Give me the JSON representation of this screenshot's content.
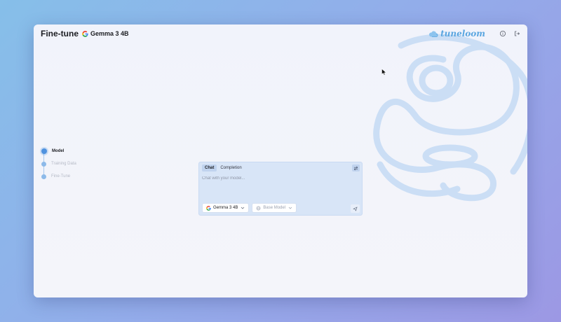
{
  "header": {
    "title": "Fine-tune",
    "model_name": "Gemma 3 4B",
    "brand": "tuneloom"
  },
  "stepper": {
    "steps": [
      {
        "label": "Model",
        "active": true
      },
      {
        "label": "Training Data",
        "active": false
      },
      {
        "label": "Fine-Tune",
        "active": false
      }
    ]
  },
  "chat": {
    "tabs": [
      "Chat",
      "Completion"
    ],
    "active_tab": "Chat",
    "input_placeholder": "Chat with your model...",
    "input_value": "",
    "model_select": "Gemma 3 4B",
    "base_model_select": "Base Model"
  },
  "icons": {
    "model_logo": "google-g-icon",
    "brand_logo": "cloud-icon",
    "info": "info-icon",
    "logout": "logout-icon",
    "swap": "swap-arrows-icon",
    "send": "send-icon",
    "base_model": "globe-icon",
    "dropdown": "chevron-down-icon"
  },
  "colors": {
    "accent": "#4f92df",
    "brand": "#5aa6e0",
    "chat_bg": "#d8e5f7",
    "swirl": "#c9ddf6"
  }
}
